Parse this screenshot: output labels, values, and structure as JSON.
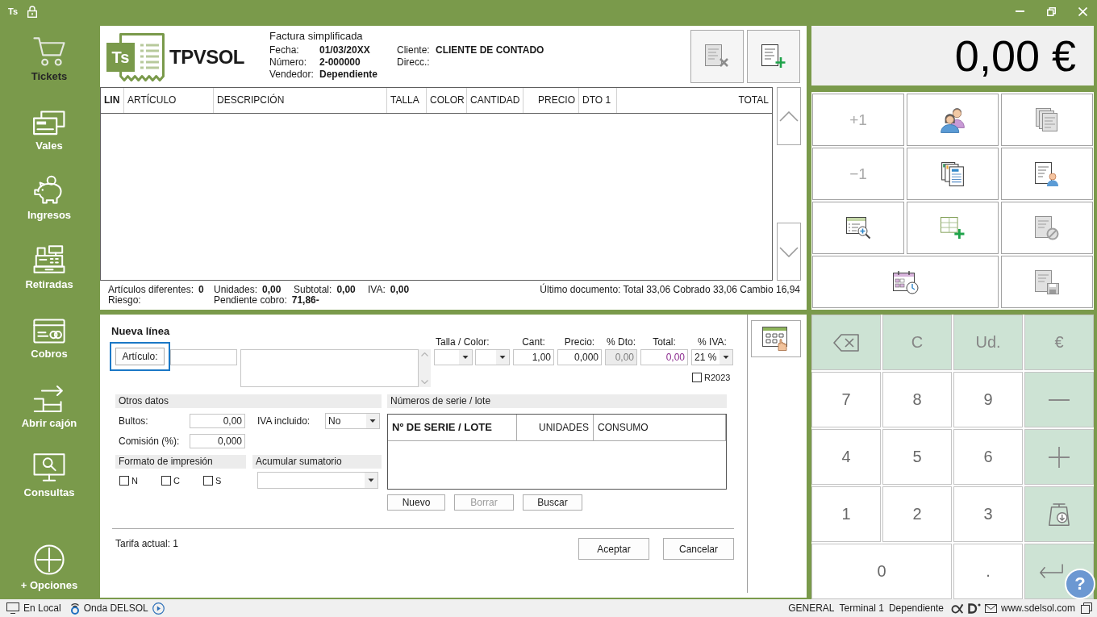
{
  "title_bar": {
    "app_badge": "Ts"
  },
  "sidebar": {
    "items": [
      {
        "kind": "cart",
        "label": "Tickets",
        "selected": true
      },
      {
        "kind": "vouchers",
        "label": "Vales",
        "selected": false
      },
      {
        "kind": "piggy-bank",
        "label": "Ingresos",
        "selected": false
      },
      {
        "kind": "register",
        "label": "Retiradas",
        "selected": false
      },
      {
        "kind": "card",
        "label": "Cobros",
        "selected": false
      },
      {
        "kind": "drawer",
        "label": "Abrir cajón",
        "selected": false
      },
      {
        "kind": "monitor-search",
        "label": "Consultas",
        "selected": false
      },
      {
        "kind": "plus-circle",
        "label": "+ Opciones",
        "selected": false
      }
    ]
  },
  "header": {
    "logo": {
      "badge": "Ts",
      "name": "TPVSOL"
    },
    "document": {
      "title": "Factura simplificada",
      "fields": [
        {
          "label": "Fecha:",
          "value": "01/03/20XX"
        },
        {
          "label": "Número:",
          "value": "2-000000"
        },
        {
          "label": "Vendedor:",
          "value": "Dependiente"
        }
      ]
    },
    "client": {
      "fields": [
        {
          "label": "Cliente:",
          "value": "CLIENTE DE CONTADO"
        },
        {
          "label": "Direcc.:"
        }
      ]
    },
    "actions": [
      {
        "kind": "delete-ticket",
        "disabled": true
      },
      {
        "kind": "new-ticket",
        "disabled": false
      }
    ]
  },
  "lines_table": {
    "columns": [
      "LIN",
      "ARTÍCULO",
      "DESCRIPCIÓN",
      "TALLA",
      "COLOR",
      "CANTIDAD",
      "PRECIO",
      "DTO 1",
      "TOTAL"
    ]
  },
  "totals": {
    "rows": [
      [
        {
          "label": "Artículos diferentes:",
          "value": "0"
        },
        {
          "label": "Unidades:",
          "value": "0,00"
        },
        {
          "label": "Subtotal:",
          "value": "0,00"
        },
        {
          "label": "IVA:",
          "value": "0,00"
        }
      ],
      [
        {
          "label": "Riesgo:"
        },
        {
          "label": "Pendiente cobro:",
          "value": "71,86-"
        }
      ]
    ],
    "last_document": "Último documento: Total 33,06 Cobrado 33,06 Cambio 16,94"
  },
  "new_line": {
    "title": "Nueva línea",
    "article_button": {
      "label": "Artículo:",
      "focused": true
    },
    "fields": [
      {
        "kind": "select-pair",
        "label": "Talla / Color:",
        "disabled": false
      },
      {
        "kind": "number",
        "label": "Cant:",
        "value": "1,00",
        "disabled": false
      },
      {
        "kind": "number",
        "label": "Precio:",
        "value": "0,000",
        "disabled": false
      },
      {
        "kind": "number",
        "label": "% Dto:",
        "value": "0,00",
        "disabled": true
      },
      {
        "kind": "computed",
        "label": "Total:",
        "value": "0,00",
        "disabled": false
      },
      {
        "kind": "select",
        "label": "% IVA:",
        "value": "21 %",
        "disabled": false
      }
    ],
    "r2023": {
      "label": "R2023",
      "checked": false
    },
    "other_data": {
      "title": "Otros datos",
      "fields": [
        {
          "label": "Bultos:",
          "value": "0,00"
        },
        {
          "label": "Comisión (%):",
          "value": "0,000"
        }
      ],
      "vat_included": {
        "label": "IVA incluido:",
        "value": "No"
      }
    },
    "print_format": {
      "title": "Formato de impresión",
      "options": [
        {
          "label": "N",
          "checked": false
        },
        {
          "label": "C",
          "checked": false
        },
        {
          "label": "S",
          "checked": false
        }
      ]
    },
    "accumulate": {
      "title": "Acumular sumatorio"
    },
    "serials": {
      "title": "Números de serie / lote",
      "columns": [
        "Nº DE SERIE / LOTE",
        "UNIDADES",
        "CONSUMO"
      ],
      "buttons": [
        {
          "label": "Nuevo",
          "disabled": false
        },
        {
          "label": "Borrar",
          "disabled": true
        },
        {
          "label": "Buscar",
          "disabled": false
        }
      ]
    },
    "rate": "Tarifa actual: 1",
    "buttons": [
      "Aceptar",
      "Cancelar"
    ]
  },
  "display": {
    "amount": "0,00 €"
  },
  "function_buttons": {
    "rows": [
      [
        {
          "kind": "text",
          "label": "+1",
          "disabled": true
        },
        {
          "kind": "clients",
          "disabled": false
        },
        {
          "kind": "tickets",
          "disabled": true
        }
      ],
      [
        {
          "kind": "text",
          "label": "−1",
          "disabled": true
        },
        {
          "kind": "documents",
          "disabled": false
        },
        {
          "kind": "receipt-person",
          "disabled": false
        }
      ],
      [
        {
          "kind": "table-search",
          "disabled": false
        },
        {
          "kind": "table-add",
          "disabled": false
        },
        {
          "kind": "receipt-cancel",
          "disabled": true
        }
      ],
      [
        {
          "kind": "schedule",
          "disabled": false
        },
        "",
        {
          "kind": "save-ticket",
          "disabled": true
        }
      ]
    ]
  },
  "keypad": {
    "rows": [
      [
        {
          "kind": "backspace"
        },
        {
          "kind": "function",
          "label": "C"
        },
        {
          "kind": "function",
          "label": "Ud."
        },
        {
          "kind": "function",
          "label": "€"
        }
      ],
      [
        {
          "kind": "digit",
          "label": "7"
        },
        {
          "kind": "digit",
          "label": "8"
        },
        {
          "kind": "digit",
          "label": "9"
        },
        {
          "kind": "minus"
        }
      ],
      [
        {
          "kind": "digit",
          "label": "4"
        },
        {
          "kind": "digit",
          "label": "5"
        },
        {
          "kind": "digit",
          "label": "6"
        },
        {
          "kind": "plus"
        }
      ],
      [
        {
          "kind": "digit",
          "label": "1"
        },
        {
          "kind": "digit",
          "label": "2"
        },
        {
          "kind": "digit",
          "label": "3"
        },
        {
          "kind": "scale"
        }
      ],
      [
        {
          "kind": "digit",
          "label": "0"
        },
        "",
        {
          "kind": "digit",
          "label": "."
        },
        {
          "kind": "enter"
        }
      ]
    ]
  },
  "help_button": {
    "label": "?"
  },
  "status_bar": {
    "connection": "En Local",
    "radio": "Onda DELSOL",
    "company": "GENERAL",
    "terminal": "Terminal 1",
    "user": "Dependiente",
    "website": "www.sdelsol.com"
  }
}
